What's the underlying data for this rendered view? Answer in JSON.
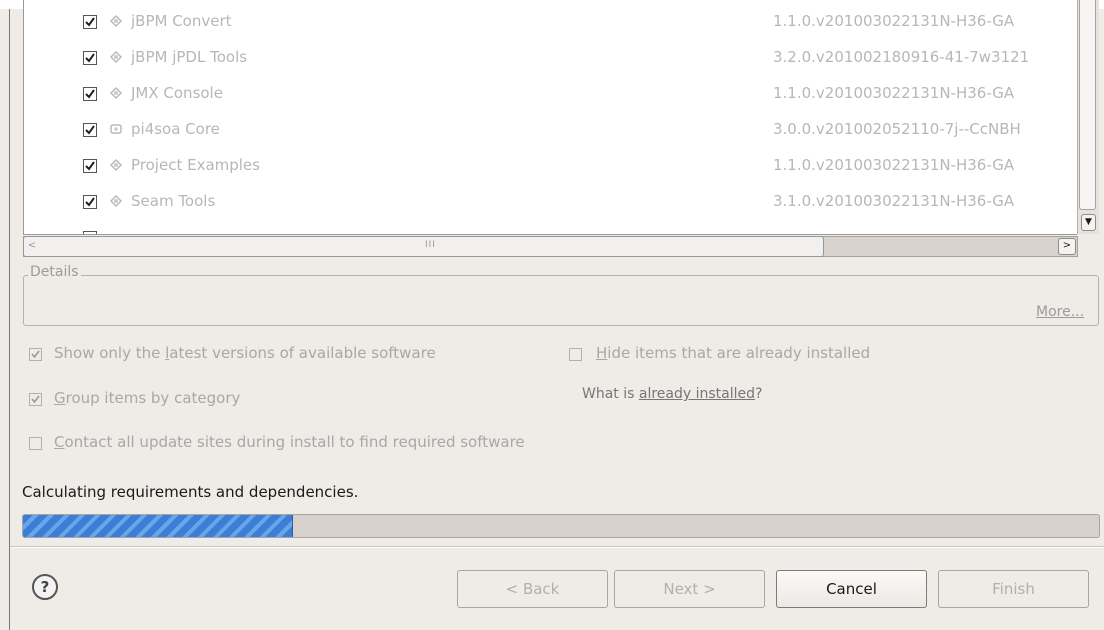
{
  "packages": [
    {
      "name": "jBPM Convert",
      "version": "1.1.0.v201003022131N-H36-GA",
      "checked": true,
      "icon": "feature-icon"
    },
    {
      "name": "jBPM jPDL Tools",
      "version": "3.2.0.v201002180916-41-7w3121",
      "checked": true,
      "icon": "feature-icon"
    },
    {
      "name": "JMX Console",
      "version": "1.1.0.v201003022131N-H36-GA",
      "checked": true,
      "icon": "feature-icon"
    },
    {
      "name": "pi4soa Core",
      "version": "3.0.0.v201002052110-7j--CcNBH",
      "checked": true,
      "icon": "plugin-icon"
    },
    {
      "name": "Project Examples",
      "version": "1.1.0.v201003022131N-H36-GA",
      "checked": true,
      "icon": "feature-icon"
    },
    {
      "name": "Seam Tools",
      "version": "3.1.0.v201003022131N-H36-GA",
      "checked": true,
      "icon": "feature-icon"
    }
  ],
  "details": {
    "title": "Details",
    "more": "More..."
  },
  "options": {
    "latest_pre": "Show only the ",
    "latest_u": "l",
    "latest_post": "atest versions of available software",
    "latest_checked": true,
    "hide_u": "H",
    "hide_post": "ide items that are already installed",
    "hide_checked": false,
    "group_u": "G",
    "group_post": "roup items by category",
    "group_checked": true,
    "what_pre": "What is ",
    "what_link": "already installed",
    "what_post": "?",
    "contact_u": "C",
    "contact_post": "ontact all update sites during install to find required software",
    "contact_checked": false
  },
  "status": {
    "text": "Calculating requirements and dependencies.",
    "progress": 0.25
  },
  "buttons": {
    "help": "?",
    "back": "< Back",
    "next": "Next >",
    "cancel": "Cancel",
    "finish": "Finish"
  },
  "scroll": {
    "h_grip": "III"
  }
}
